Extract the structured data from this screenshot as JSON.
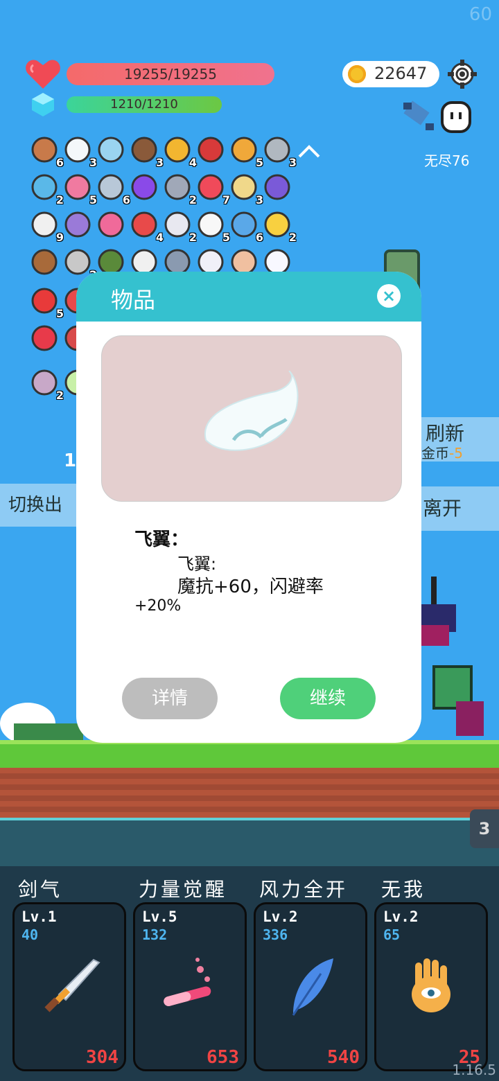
{
  "fps": "60",
  "hud": {
    "hp": "19255/19255",
    "mp": "1210/1210",
    "gold": "22647",
    "endless_label": "无尽76"
  },
  "items": [
    {
      "icon": "shield-icon",
      "count": "6"
    },
    {
      "icon": "wing-icon",
      "count": "3"
    },
    {
      "icon": "magnifier-icon",
      "count": ""
    },
    {
      "icon": "coconut-icon",
      "count": "3"
    },
    {
      "icon": "coin-stack-icon",
      "count": "4"
    },
    {
      "icon": "magnet-icon",
      "count": ""
    },
    {
      "icon": "book-icon",
      "count": "5"
    },
    {
      "icon": "spiked-mace-icon",
      "count": "3"
    },
    {
      "icon": "potion-flask-icon",
      "count": "2"
    },
    {
      "icon": "ice-cream-icon",
      "count": "5"
    },
    {
      "icon": "sword-icon",
      "count": "6"
    },
    {
      "icon": "crystal-ball-icon",
      "count": ""
    },
    {
      "icon": "battle-axe-icon",
      "count": "2"
    },
    {
      "icon": "watermelon-icon",
      "count": "7"
    },
    {
      "icon": "scroll-map-icon",
      "count": "3"
    },
    {
      "icon": "treasure-box-icon",
      "count": ""
    },
    {
      "icon": "flower-icon",
      "count": "9"
    },
    {
      "icon": "star-shield-icon",
      "count": ""
    },
    {
      "icon": "heart-card-icon",
      "count": ""
    },
    {
      "icon": "sock-icon",
      "count": "4"
    },
    {
      "icon": "envelope-icon",
      "count": "2"
    },
    {
      "icon": "dice-icon",
      "count": "5"
    },
    {
      "icon": "star-card-icon",
      "count": "6"
    },
    {
      "icon": "crown-icon",
      "count": "2"
    },
    {
      "icon": "chest-icon",
      "count": ""
    },
    {
      "icon": "bullets-icon",
      "count": "2"
    },
    {
      "icon": "grenade-icon",
      "count": ""
    },
    {
      "icon": "playing-card-icon",
      "count": ""
    },
    {
      "icon": "compass-icon",
      "count": ""
    },
    {
      "icon": "clipboard-icon",
      "count": ""
    },
    {
      "icon": "cake-icon",
      "count": ""
    },
    {
      "icon": "ghost-icon",
      "count": ""
    },
    {
      "icon": "apple-icon",
      "count": "5"
    },
    {
      "icon": "gift-icon",
      "count": ""
    },
    {
      "icon": "hearts-icon",
      "count": ""
    },
    {
      "icon": "banner-icon",
      "count": ""
    },
    {
      "icon": "stripe-card-icon",
      "count": "2"
    },
    {
      "icon": "gem-card-icon",
      "count": ""
    }
  ],
  "side_buttons": {
    "refresh": "刷新",
    "refresh_cost_label": "金币",
    "refresh_cost": "-5",
    "leave": "离开",
    "switch_partial": "切换出",
    "number_partial": "1"
  },
  "dialog": {
    "title": "物品",
    "close": "×",
    "item_name": "飞翼：",
    "desc_line1": "飞翼:",
    "desc_line2": "魔抗+60，闪避率",
    "desc_line3": "+20%",
    "detail_button": "详情",
    "continue_button": "继续"
  },
  "counter_tab": "3",
  "skills": [
    {
      "name": "剑气",
      "level": "Lv.1",
      "power": "40",
      "cost": "304",
      "icon": "sword-icon"
    },
    {
      "name": "力量觉醒",
      "level": "Lv.5",
      "power": "132",
      "cost": "653",
      "icon": "test-tube-icon"
    },
    {
      "name": "风力全开",
      "level": "Lv.2",
      "power": "336",
      "cost": "540",
      "icon": "feather-icon"
    },
    {
      "name": "无我",
      "level": "Lv.2",
      "power": "65",
      "cost": "25",
      "icon": "eye-hand-icon"
    }
  ],
  "version": "1.16.5",
  "colors": {
    "background": "#3aa6f0",
    "dialog_header": "#35c1cf",
    "continue": "#4fd07a",
    "detail": "#bdbdbd",
    "cost_red": "#f04444",
    "power_blue": "#4fb6f0"
  }
}
